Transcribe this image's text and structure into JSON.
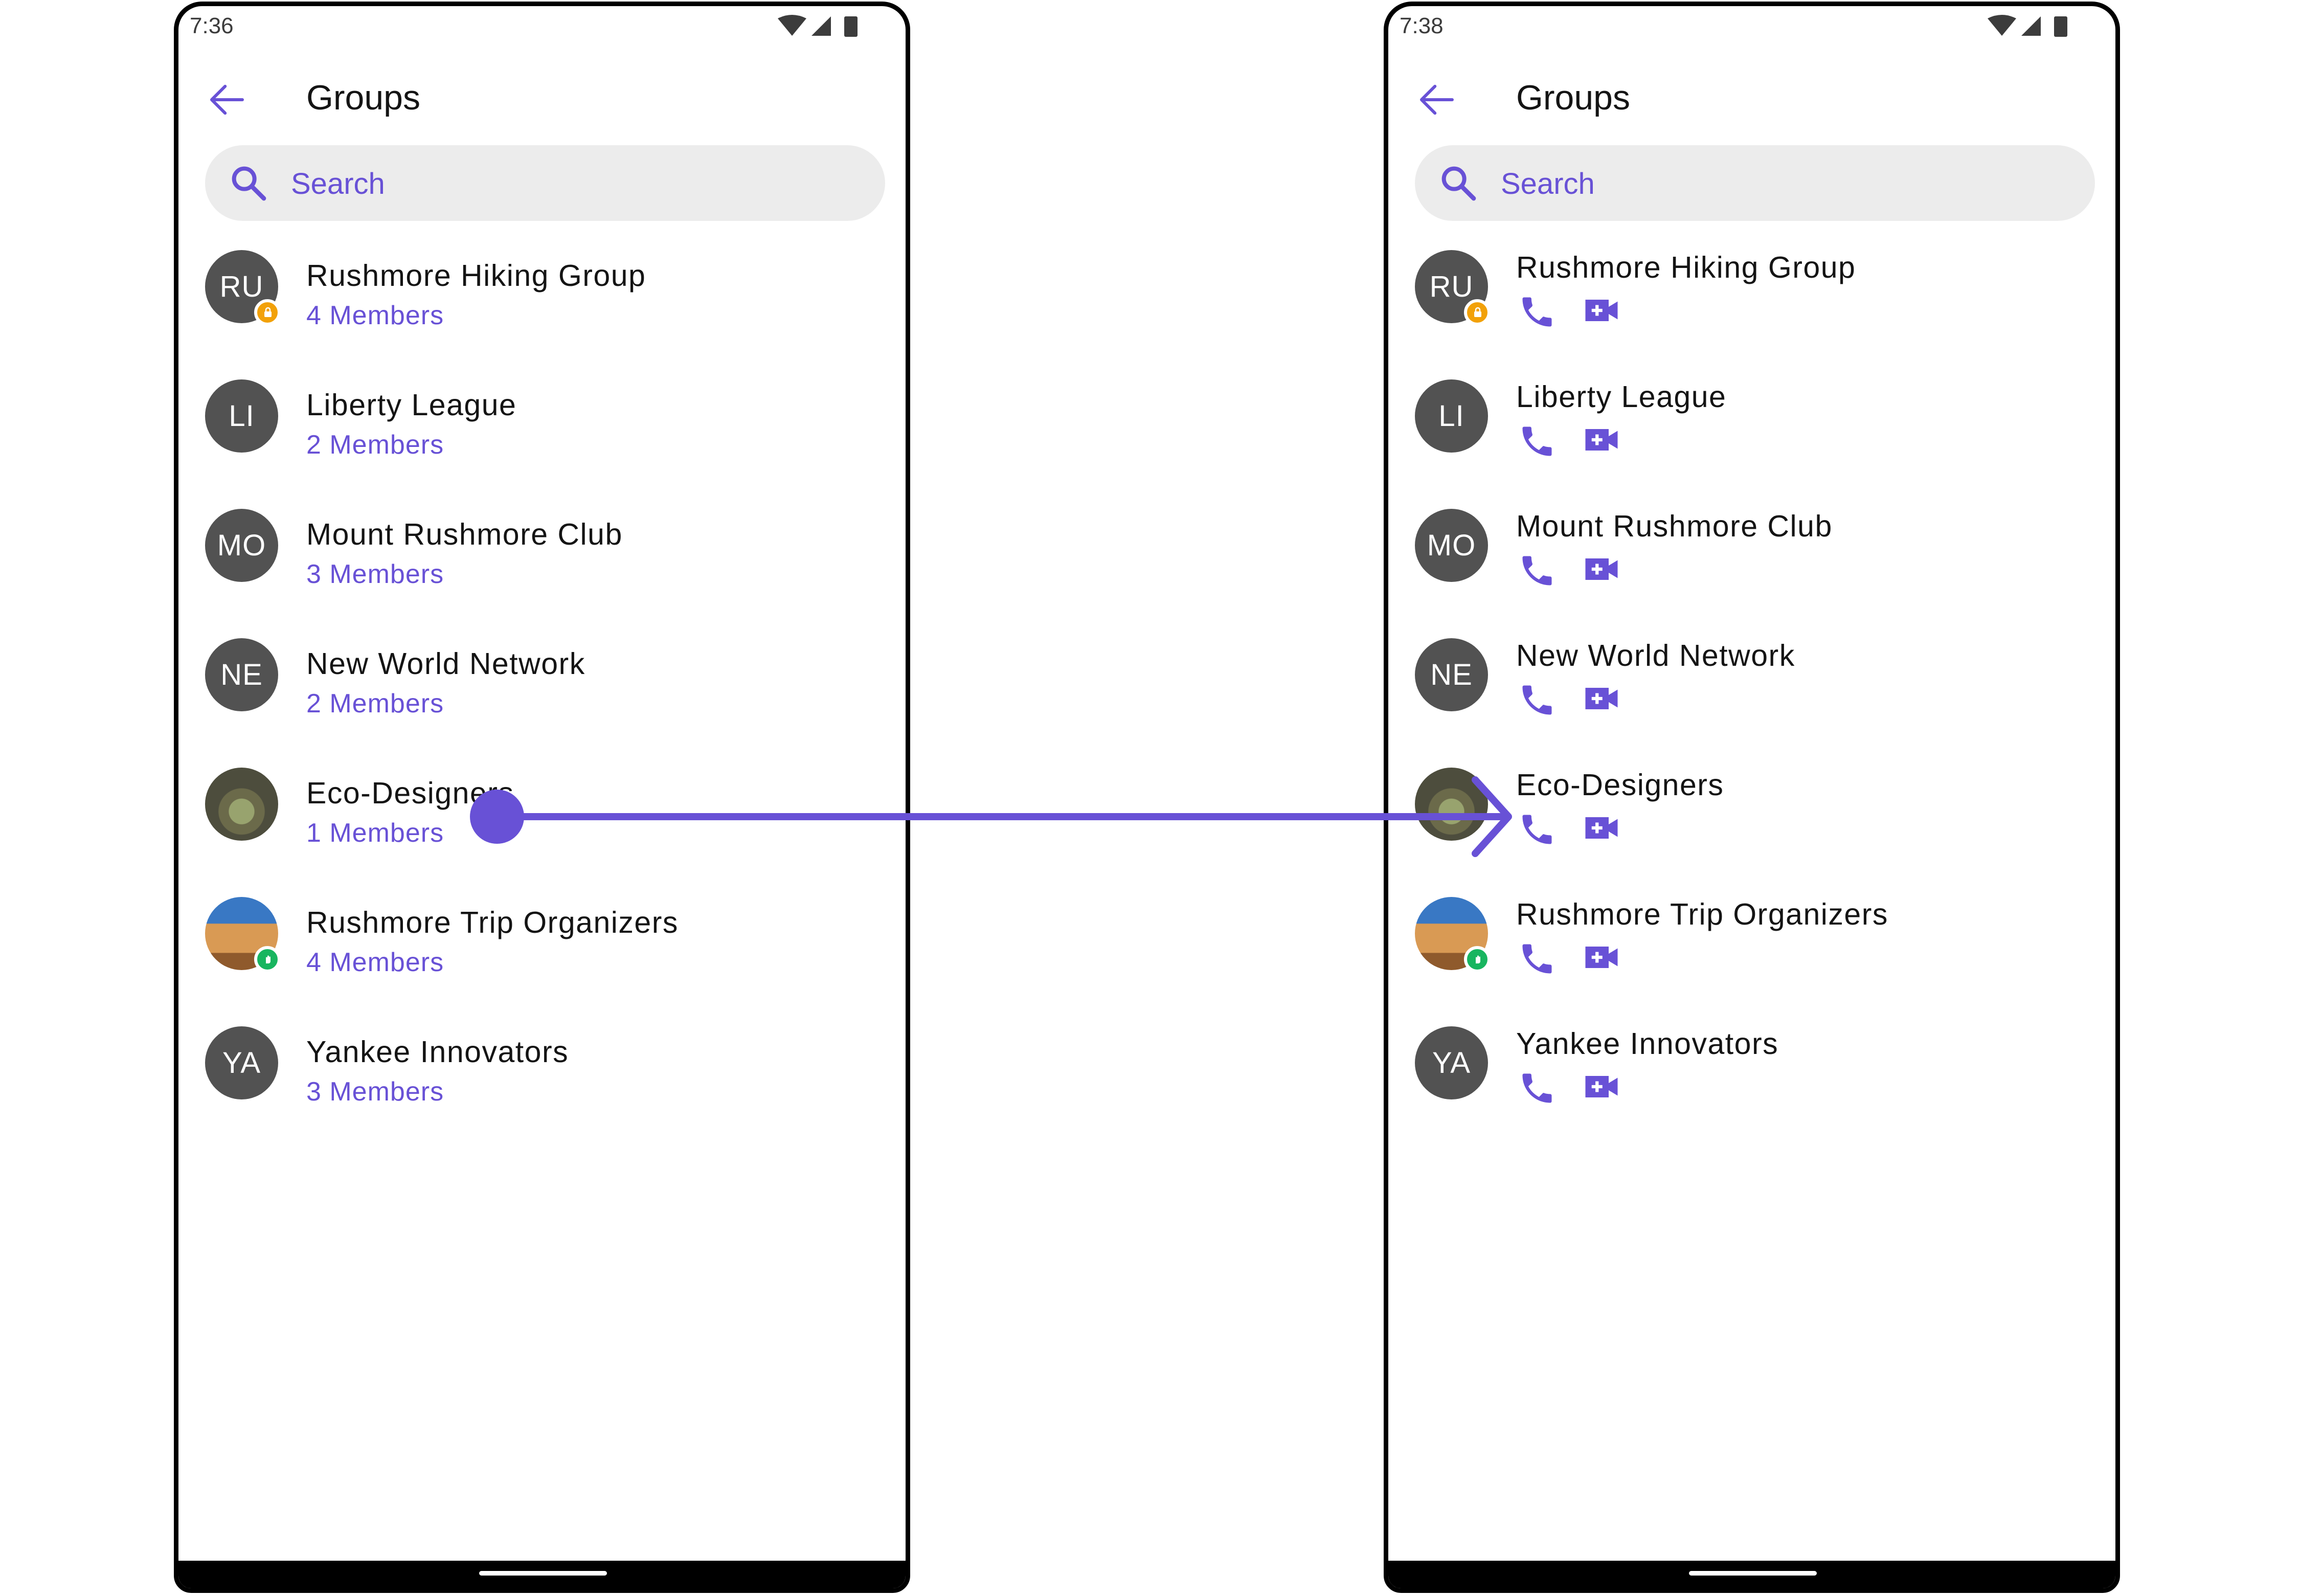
{
  "colors": {
    "accent": "#6851d6",
    "avatar_bg": "#525252",
    "search_bg": "#ececec",
    "private_badge": "#f2a109",
    "password_badge": "#18b55f"
  },
  "left": {
    "status_time": "7:36",
    "title": "Groups",
    "search_placeholder": "Search",
    "groups": [
      {
        "name": "Rushmore Hiking Group",
        "members": "4 Members",
        "initials": "RU",
        "badge": "private"
      },
      {
        "name": "Liberty League",
        "members": "2 Members",
        "initials": "LI"
      },
      {
        "name": "Mount Rushmore Club",
        "members": "3 Members",
        "initials": "MO"
      },
      {
        "name": "New World Network",
        "members": "2 Members",
        "initials": "NE"
      },
      {
        "name": "Eco-Designers",
        "members": "1 Members",
        "initials": "",
        "avatar_image": "hands-plant"
      },
      {
        "name": "Rushmore Trip Organizers",
        "members": "4 Members",
        "initials": "",
        "avatar_image": "mount-rushmore",
        "badge": "password"
      },
      {
        "name": "Yankee Innovators",
        "members": "3 Members",
        "initials": "YA"
      }
    ]
  },
  "right": {
    "status_time": "7:38",
    "title": "Groups",
    "search_placeholder": "Search",
    "groups": [
      {
        "name": "Rushmore Hiking Group",
        "initials": "RU",
        "badge": "private"
      },
      {
        "name": "Liberty League",
        "initials": "LI"
      },
      {
        "name": "Mount Rushmore Club",
        "initials": "MO"
      },
      {
        "name": "New World Network",
        "initials": "NE"
      },
      {
        "name": "Eco-Designers",
        "initials": "",
        "avatar_image": "hands-plant"
      },
      {
        "name": "Rushmore Trip Organizers",
        "initials": "",
        "avatar_image": "mount-rushmore",
        "badge": "password"
      },
      {
        "name": "Yankee Innovators",
        "initials": "YA"
      }
    ],
    "row_icons": [
      "phone-call-icon",
      "video-call-icon"
    ]
  }
}
